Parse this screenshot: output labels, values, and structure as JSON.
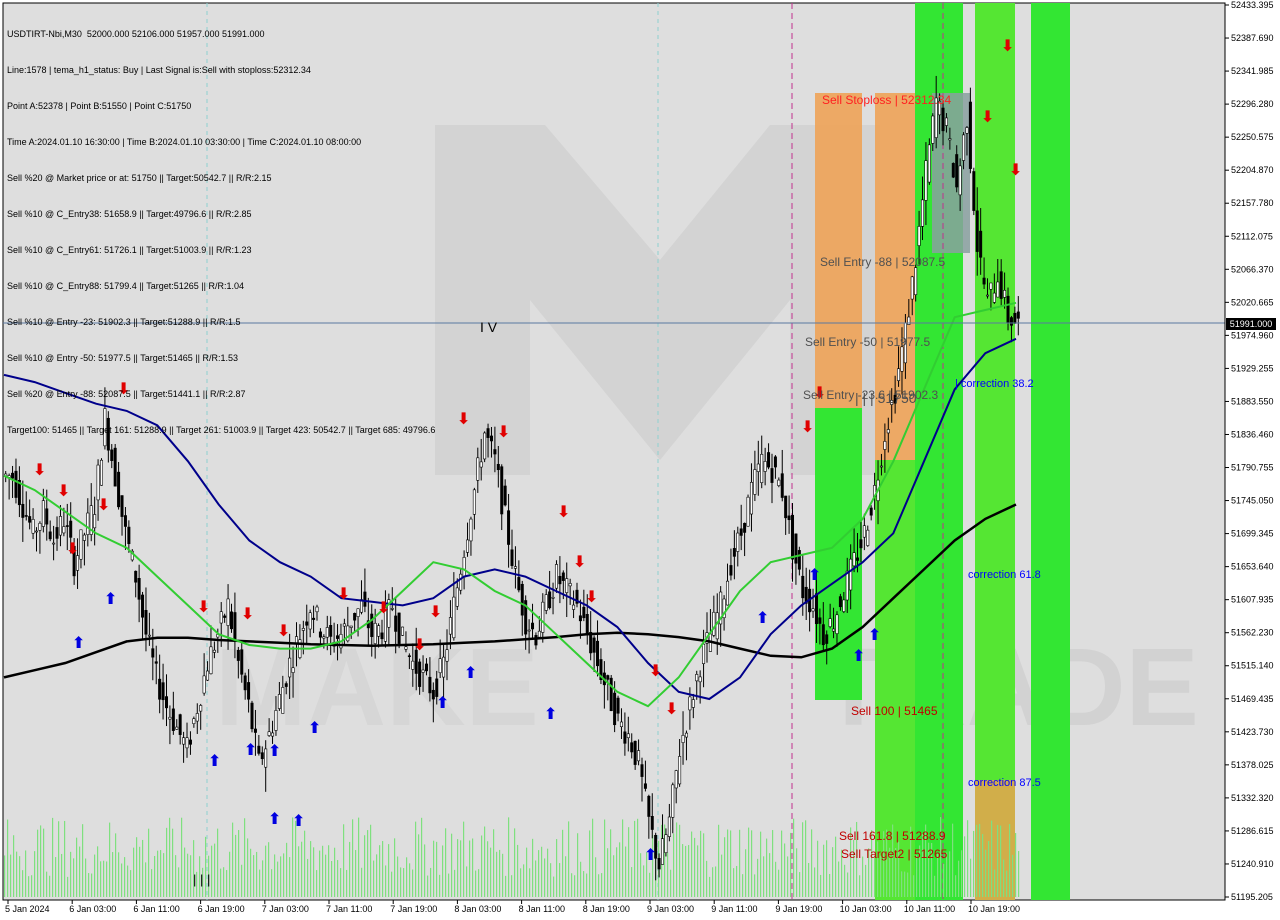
{
  "header": {
    "symbol_line": "USDTIRT-Nbi,M30  52000.000 52106.000 51957.000 51991.000",
    "lines": [
      "Line:1578 | tema_h1_status: Buy | Last Signal is:Sell with stoploss:52312.34",
      "Point A:52378 | Point B:51550 | Point C:51750",
      "Time A:2024.01.10 16:30:00 | Time B:2024.01.10 03:30:00 | Time C:2024.01.10 08:00:00",
      "Sell %20 @ Market price or at: 51750 || Target:50542.7 || R/R:2.15",
      "Sell %10 @ C_Entry38: 51658.9 || Target:49796.6 || R/R:2.85",
      "Sell %10 @ C_Entry61: 51726.1 || Target:51003.9 || R/R:1.23",
      "Sell %10 @ C_Entry88: 51799.4 || Target:51265 || R/R:1.04",
      "Sell %10 @ Entry -23: 51902.3 || Target:51288.9 || R/R:1.5",
      "Sell %10 @ Entry -50: 51977.5 || Target:51465 || R/R:1.53",
      "Sell %20 @ Entry -88: 52087.5 || Target:51441.1 || R/R:2.87",
      "Target100: 51465 || Target 161: 51288.9 || Target 261: 51003.9 || Target 423: 50542.7 || Target 685: 49796.6"
    ]
  },
  "current_price": "51991.000",
  "chart_data": {
    "type": "candlestick",
    "symbol": "USDTIRT-Nbi",
    "timeframe": "M30",
    "ylim": [
      51195.205,
      52433.395
    ],
    "y_ticks": [
      "52433.395",
      "52387.690",
      "52341.985",
      "52296.280",
      "52250.575",
      "52204.870",
      "52157.780",
      "52112.075",
      "52066.370",
      "52020.665",
      "51974.960",
      "51929.255",
      "51883.550",
      "51836.460",
      "51790.755",
      "51745.050",
      "51699.345",
      "51653.640",
      "51607.935",
      "51562.230",
      "51515.140",
      "51469.435",
      "51423.730",
      "51378.025",
      "51332.320",
      "51286.615",
      "51240.910",
      "51195.205"
    ],
    "x_ticks": [
      "5 Jan 2024",
      "6 Jan 03:00",
      "6 Jan 11:00",
      "6 Jan 19:00",
      "7 Jan 03:00",
      "7 Jan 11:00",
      "7 Jan 19:00",
      "8 Jan 03:00",
      "8 Jan 11:00",
      "8 Jan 19:00",
      "9 Jan 03:00",
      "9 Jan 11:00",
      "9 Jan 19:00",
      "10 Jan 03:00",
      "10 Jan 11:00",
      "10 Jan 19:00"
    ],
    "closes": [
      51780,
      51740,
      51700,
      51730,
      51690,
      51720,
      51660,
      51700,
      51740,
      51860,
      51780,
      51700,
      51640,
      51560,
      51500,
      51460,
      51430,
      51400,
      51460,
      51520,
      51560,
      51600,
      51520,
      51460,
      51380,
      51420,
      51470,
      51520,
      51560,
      51600,
      51570,
      51550,
      51560,
      51580,
      51600,
      51560,
      51570,
      51600,
      51550,
      51520,
      51500,
      51480,
      51520,
      51600,
      51680,
      51760,
      51840,
      51800,
      51720,
      51640,
      51580,
      51560,
      51600,
      51640,
      51620,
      51600,
      51560,
      51520,
      51480,
      51440,
      51420,
      51380,
      51300,
      51240,
      51300,
      51400,
      51460,
      51520,
      51560,
      51600,
      51660,
      51700,
      51760,
      51800,
      51790,
      51760,
      51680,
      51620,
      51600,
      51560,
      51580,
      51620,
      51660,
      51700,
      51760,
      51840,
      51900,
      51980,
      52080,
      52200,
      52300,
      52260,
      52180,
      52280,
      52100,
      52020,
      52060,
      52000,
      51991
    ],
    "series": [
      {
        "name": "",
        "color": "#000000",
        "values": [
          51500,
          51510,
          51520,
          51535,
          51550,
          51555,
          51555,
          51552,
          51550,
          51548,
          51546,
          51545,
          51544,
          51545,
          51546,
          51548,
          51550,
          51553,
          51556,
          51560,
          51562,
          51560,
          51556,
          51550,
          51540,
          51530,
          51528,
          51540,
          51570,
          51610,
          51650,
          51690,
          51720,
          51740
        ]
      },
      {
        "name": "",
        "color": "#00008b",
        "values": [
          51920,
          51910,
          51895,
          51880,
          51870,
          51850,
          51800,
          51740,
          51690,
          51660,
          51640,
          51610,
          51605,
          51600,
          51610,
          51640,
          51650,
          51640,
          51620,
          51600,
          51570,
          51520,
          51480,
          51470,
          51500,
          51560,
          51600,
          51630,
          51660,
          51700,
          51800,
          51900,
          51950,
          51970
        ]
      },
      {
        "name": "",
        "color": "#32cd32",
        "values": [
          51780,
          51760,
          51730,
          51700,
          51680,
          51640,
          51600,
          51560,
          51545,
          51540,
          51540,
          51550,
          51580,
          51620,
          51660,
          51650,
          51620,
          51600,
          51560,
          51520,
          51480,
          51460,
          51500,
          51560,
          51620,
          51660,
          51670,
          51680,
          51720,
          51800,
          51900,
          52000,
          52010,
          52020
        ]
      }
    ],
    "annotations": [
      {
        "text": "Sell Stoploss | 52312.34",
        "color": "#ff0000"
      },
      {
        "text": "Sell Entry -88 | 52087.5",
        "color": "#505050"
      },
      {
        "text": "Sell Entry -50 | 51977.5",
        "color": "#505050"
      },
      {
        "text": "Sell Entry -23.6 | 51902.3",
        "color": "#505050"
      },
      {
        "text": "| | | 51750",
        "color": "#505050"
      },
      {
        "text": "| correction 38.2",
        "color": "#0000ff"
      },
      {
        "text": "correction 61.8",
        "color": "#0000ff"
      },
      {
        "text": "correction 87.5",
        "color": "#0000ff"
      },
      {
        "text": "Sell 100 | 51465",
        "color": "#c00000"
      },
      {
        "text": "Sell 161.8 | 51288.9",
        "color": "#c00000"
      },
      {
        "text": "Sell Target2 | 51265",
        "color": "#c00000"
      },
      {
        "text": "I V",
        "color": "#000000"
      },
      {
        "text": "| | |",
        "color": "#000000"
      }
    ],
    "watermark": "MAKETRADE"
  }
}
